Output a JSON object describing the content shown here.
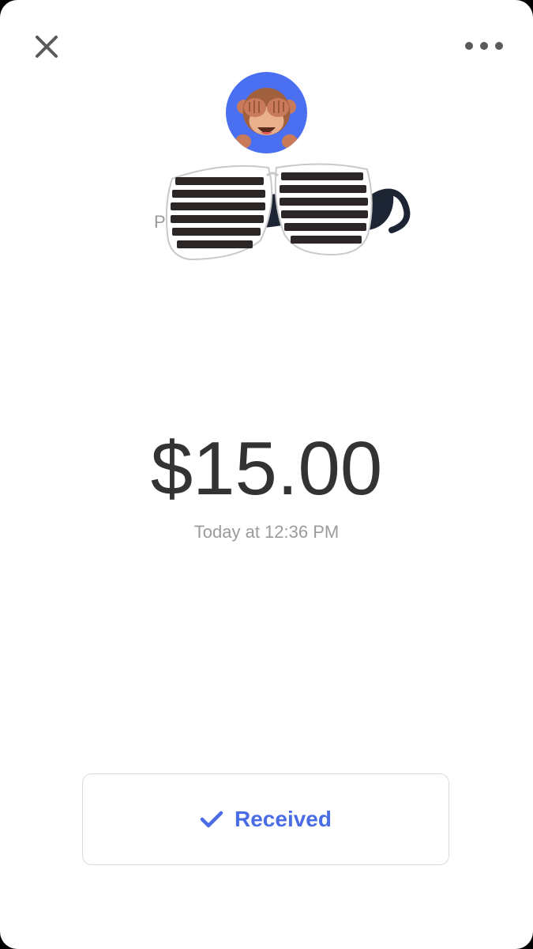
{
  "header": {
    "close_icon": "close-icon",
    "more_icon": "more-horizontal-icon"
  },
  "sender": {
    "avatar_emoji": "see-no-evil-monkey",
    "avatar_bg": "#4a6ff0",
    "name_partial": "P"
  },
  "sticker": {
    "type": "shutter-shades-and-mustache"
  },
  "payment": {
    "amount": "$15.00",
    "timestamp": "Today at 12:36 PM",
    "status": "Received",
    "status_icon": "checkmark-icon",
    "status_color": "#4a6de5"
  }
}
